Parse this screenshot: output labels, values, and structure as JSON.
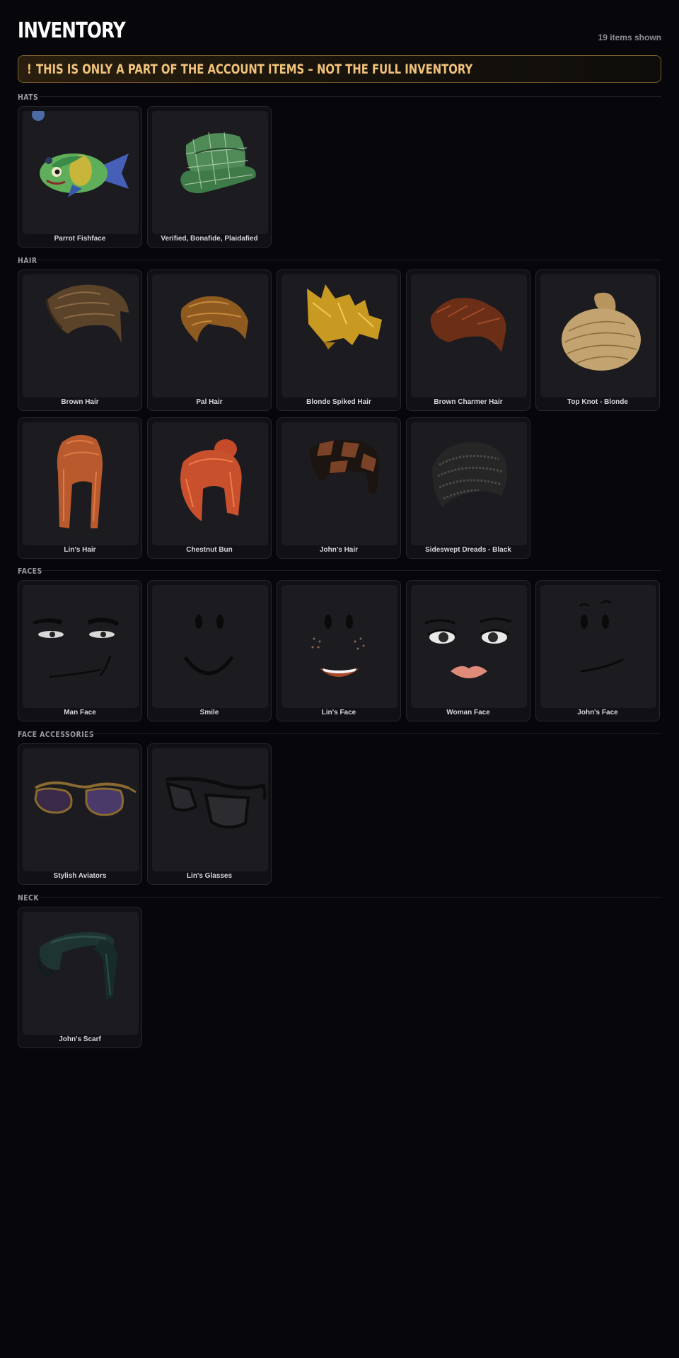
{
  "page": {
    "title": "INVENTORY",
    "items_shown": "19 items shown",
    "banner": {
      "icon": "!",
      "text": "THIS IS ONLY A PART OF THE ACCOUNT ITEMS – NOT THE FULL INVENTORY"
    }
  },
  "sections": {
    "hats": {
      "title": "HATS",
      "items": [
        {
          "name": "Parrot Fishface",
          "icon": "parrot-fish-icon"
        },
        {
          "name": "Verified, Bonafide, Plaidafied",
          "icon": "plaid-cap-icon"
        }
      ]
    },
    "hair": {
      "title": "HAIR",
      "items": [
        {
          "name": "Brown Hair",
          "icon": "brown-hair-icon"
        },
        {
          "name": "Pal Hair",
          "icon": "pal-hair-icon"
        },
        {
          "name": "Blonde Spiked Hair",
          "icon": "blonde-spiked-hair-icon"
        },
        {
          "name": "Brown Charmer Hair",
          "icon": "brown-charmer-hair-icon"
        },
        {
          "name": "Top Knot - Blonde",
          "icon": "top-knot-icon"
        },
        {
          "name": "Lin's Hair",
          "icon": "lin-hair-icon"
        },
        {
          "name": "Chestnut Bun",
          "icon": "chestnut-bun-icon"
        },
        {
          "name": "John's Hair",
          "icon": "john-hair-icon"
        },
        {
          "name": "Sideswept Dreads - Black",
          "icon": "dreads-icon"
        }
      ]
    },
    "faces": {
      "title": "FACES",
      "items": [
        {
          "name": "Man Face",
          "icon": "man-face-icon"
        },
        {
          "name": "Smile",
          "icon": "smile-face-icon"
        },
        {
          "name": "Lin's Face",
          "icon": "lin-face-icon"
        },
        {
          "name": "Woman Face",
          "icon": "woman-face-icon"
        },
        {
          "name": "John's Face",
          "icon": "john-face-icon"
        }
      ]
    },
    "face_accessories": {
      "title": "FACE ACCESSORIES",
      "items": [
        {
          "name": "Stylish Aviators",
          "icon": "aviators-icon"
        },
        {
          "name": "Lin's Glasses",
          "icon": "glasses-icon"
        }
      ]
    },
    "neck": {
      "title": "NECK",
      "items": [
        {
          "name": "John's Scarf",
          "icon": "scarf-icon"
        }
      ]
    }
  },
  "colors": {
    "background": "#07070b",
    "card": "#101015",
    "thumb": "#1b1b20",
    "banner_text": "#f1c27a",
    "banner_border": "#7a5f2b"
  }
}
